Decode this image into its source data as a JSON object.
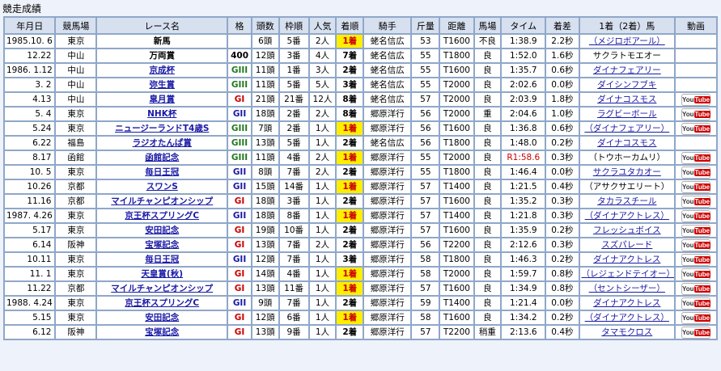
{
  "section_title": "競走成績",
  "headers": [
    "年月日",
    "競馬場",
    "レース名",
    "格",
    "頭数",
    "枠順",
    "人気",
    "着順",
    "騎手",
    "斤量",
    "距離",
    "馬場",
    "タイム",
    "着差",
    "1着（2着）馬",
    "動画"
  ],
  "grade_colors": {
    "GI": "#cc0000",
    "GII": "#1a1aa6",
    "GIII": "#227722",
    "400": "#000000"
  },
  "rows": [
    {
      "date": "1985.10. 6",
      "course": "東京",
      "race": "新馬",
      "race_link": false,
      "grade": "",
      "field": "6頭",
      "gate": "5番",
      "fav": "2人",
      "place": "1着",
      "jockey": "蛯名信広",
      "weight": "53",
      "distance": "T1600",
      "going": "不良",
      "time": "1:38.9",
      "record": "",
      "margin": "2.2秒",
      "winner": "（メジロボアール）",
      "winner_link": true,
      "video": false
    },
    {
      "date": "12.22",
      "course": "中山",
      "race": "万両賞",
      "race_link": false,
      "grade": "400",
      "field": "12頭",
      "gate": "3番",
      "fav": "4人",
      "place": "7着",
      "jockey": "蛯名信広",
      "weight": "55",
      "distance": "T1800",
      "going": "良",
      "time": "1:52.0",
      "record": "",
      "margin": "1.6秒",
      "winner": "サクラトモエオー",
      "winner_link": false,
      "video": false
    },
    {
      "date": "1986. 1.12",
      "course": "中山",
      "race": "京成杯",
      "race_link": true,
      "grade": "GIII",
      "field": "11頭",
      "gate": "1番",
      "fav": "3人",
      "place": "2着",
      "jockey": "蛯名信広",
      "weight": "55",
      "distance": "T1600",
      "going": "良",
      "time": "1:35.7",
      "record": "",
      "margin": "0.6秒",
      "winner": "ダイナフェアリー",
      "winner_link": true,
      "video": false
    },
    {
      "date": "3. 2",
      "course": "中山",
      "race": "弥生賞",
      "race_link": true,
      "grade": "GIII",
      "field": "11頭",
      "gate": "5番",
      "fav": "5人",
      "place": "3着",
      "jockey": "蛯名信広",
      "weight": "55",
      "distance": "T2000",
      "going": "良",
      "time": "2:02.6",
      "record": "",
      "margin": "0.0秒",
      "winner": "ダイシンフブキ",
      "winner_link": true,
      "video": false
    },
    {
      "date": "4.13",
      "course": "中山",
      "race": "皐月賞",
      "race_link": true,
      "grade": "GI",
      "field": "21頭",
      "gate": "21番",
      "fav": "12人",
      "place": "8着",
      "jockey": "蛯名信広",
      "weight": "57",
      "distance": "T2000",
      "going": "良",
      "time": "2:03.9",
      "record": "",
      "margin": "1.8秒",
      "winner": "ダイナコスモス",
      "winner_link": true,
      "video": true
    },
    {
      "date": "5. 4",
      "course": "東京",
      "race": "NHK杯",
      "race_link": true,
      "grade": "GII",
      "field": "18頭",
      "gate": "2番",
      "fav": "2人",
      "place": "8着",
      "jockey": "郷原洋行",
      "weight": "56",
      "distance": "T2000",
      "going": "重",
      "time": "2:04.6",
      "record": "",
      "margin": "1.0秒",
      "winner": "ラグビーボール",
      "winner_link": true,
      "video": true
    },
    {
      "date": "5.24",
      "course": "東京",
      "race": "ニュージーランドT4歳S",
      "race_link": true,
      "grade": "GIII",
      "field": "7頭",
      "gate": "2番",
      "fav": "1人",
      "place": "1着",
      "jockey": "郷原洋行",
      "weight": "56",
      "distance": "T1600",
      "going": "良",
      "time": "1:36.8",
      "record": "",
      "margin": "0.6秒",
      "winner": "（ダイナフェアリー）",
      "winner_link": true,
      "video": true
    },
    {
      "date": "6.22",
      "course": "福島",
      "race": "ラジオたんぱ賞",
      "race_link": true,
      "grade": "GIII",
      "field": "13頭",
      "gate": "5番",
      "fav": "1人",
      "place": "2着",
      "jockey": "蛯名信広",
      "weight": "56",
      "distance": "T1800",
      "going": "良",
      "time": "1:48.0",
      "record": "",
      "margin": "0.2秒",
      "winner": "ダイナコスモス",
      "winner_link": true,
      "video": false
    },
    {
      "date": "8.17",
      "course": "函館",
      "race": "函館記念",
      "race_link": true,
      "grade": "GIII",
      "field": "11頭",
      "gate": "4番",
      "fav": "2人",
      "place": "1着",
      "jockey": "郷原洋行",
      "weight": "55",
      "distance": "T2000",
      "going": "良",
      "time": "1:58.6",
      "record": "R",
      "margin": "0.3秒",
      "winner": "（トウホーカムリ）",
      "winner_link": false,
      "video": true
    },
    {
      "date": "10. 5",
      "course": "東京",
      "race": "毎日王冠",
      "race_link": true,
      "grade": "GII",
      "field": "8頭",
      "gate": "7番",
      "fav": "2人",
      "place": "2着",
      "jockey": "郷原洋行",
      "weight": "55",
      "distance": "T1800",
      "going": "良",
      "time": "1:46.4",
      "record": "",
      "margin": "0.0秒",
      "winner": "サクラユタカオー",
      "winner_link": true,
      "video": true
    },
    {
      "date": "10.26",
      "course": "京都",
      "race": "スワンS",
      "race_link": true,
      "grade": "GII",
      "field": "15頭",
      "gate": "14番",
      "fav": "1人",
      "place": "1着",
      "jockey": "郷原洋行",
      "weight": "57",
      "distance": "T1400",
      "going": "良",
      "time": "1:21.5",
      "record": "",
      "margin": "0.4秒",
      "winner": "（アサクサエリート）",
      "winner_link": false,
      "video": true
    },
    {
      "date": "11.16",
      "course": "京都",
      "race": "マイルチャンピオンシップ",
      "race_link": true,
      "grade": "GI",
      "field": "18頭",
      "gate": "3番",
      "fav": "1人",
      "place": "2着",
      "jockey": "郷原洋行",
      "weight": "57",
      "distance": "T1600",
      "going": "良",
      "time": "1:35.2",
      "record": "",
      "margin": "0.3秒",
      "winner": "タカラスチール",
      "winner_link": true,
      "video": true
    },
    {
      "date": "1987. 4.26",
      "course": "東京",
      "race": "京王杯スプリングC",
      "race_link": true,
      "grade": "GII",
      "field": "18頭",
      "gate": "8番",
      "fav": "1人",
      "place": "1着",
      "jockey": "郷原洋行",
      "weight": "57",
      "distance": "T1400",
      "going": "良",
      "time": "1:21.8",
      "record": "",
      "margin": "0.3秒",
      "winner": "（ダイナアクトレス）",
      "winner_link": true,
      "video": true
    },
    {
      "date": "5.17",
      "course": "東京",
      "race": "安田記念",
      "race_link": true,
      "grade": "GI",
      "field": "19頭",
      "gate": "10番",
      "fav": "1人",
      "place": "2着",
      "jockey": "郷原洋行",
      "weight": "57",
      "distance": "T1600",
      "going": "良",
      "time": "1:35.9",
      "record": "",
      "margin": "0.2秒",
      "winner": "フレッシュボイス",
      "winner_link": true,
      "video": true
    },
    {
      "date": "6.14",
      "course": "阪神",
      "race": "宝塚記念",
      "race_link": true,
      "grade": "GI",
      "field": "13頭",
      "gate": "7番",
      "fav": "2人",
      "place": "2着",
      "jockey": "郷原洋行",
      "weight": "56",
      "distance": "T2200",
      "going": "良",
      "time": "2:12.6",
      "record": "",
      "margin": "0.3秒",
      "winner": "スズパレード",
      "winner_link": true,
      "video": true
    },
    {
      "date": "10.11",
      "course": "東京",
      "race": "毎日王冠",
      "race_link": true,
      "grade": "GII",
      "field": "12頭",
      "gate": "7番",
      "fav": "1人",
      "place": "3着",
      "jockey": "郷原洋行",
      "weight": "58",
      "distance": "T1800",
      "going": "良",
      "time": "1:46.3",
      "record": "",
      "margin": "0.2秒",
      "winner": "ダイナアクトレス",
      "winner_link": true,
      "video": true
    },
    {
      "date": "11. 1",
      "course": "東京",
      "race": "天皇賞(秋)",
      "race_link": true,
      "grade": "GI",
      "field": "14頭",
      "gate": "4番",
      "fav": "1人",
      "place": "1着",
      "jockey": "郷原洋行",
      "weight": "58",
      "distance": "T2000",
      "going": "良",
      "time": "1:59.7",
      "record": "",
      "margin": "0.8秒",
      "winner": "（レジェンドテイオー）",
      "winner_link": true,
      "video": true
    },
    {
      "date": "11.22",
      "course": "京都",
      "race": "マイルチャンピオンシップ",
      "race_link": true,
      "grade": "GI",
      "field": "13頭",
      "gate": "11番",
      "fav": "1人",
      "place": "1着",
      "jockey": "郷原洋行",
      "weight": "57",
      "distance": "T1600",
      "going": "良",
      "time": "1:34.9",
      "record": "",
      "margin": "0.8秒",
      "winner": "（セントシーザー）",
      "winner_link": true,
      "video": true
    },
    {
      "date": "1988. 4.24",
      "course": "東京",
      "race": "京王杯スプリングC",
      "race_link": true,
      "grade": "GII",
      "field": "9頭",
      "gate": "7番",
      "fav": "1人",
      "place": "2着",
      "jockey": "郷原洋行",
      "weight": "59",
      "distance": "T1400",
      "going": "良",
      "time": "1:21.4",
      "record": "",
      "margin": "0.0秒",
      "winner": "ダイナアクトレス",
      "winner_link": true,
      "video": true
    },
    {
      "date": "5.15",
      "course": "東京",
      "race": "安田記念",
      "race_link": true,
      "grade": "GI",
      "field": "12頭",
      "gate": "6番",
      "fav": "1人",
      "place": "1着",
      "jockey": "郷原洋行",
      "weight": "58",
      "distance": "T1600",
      "going": "良",
      "time": "1:34.2",
      "record": "",
      "margin": "0.2秒",
      "winner": "（ダイナアクトレス）",
      "winner_link": true,
      "video": true
    },
    {
      "date": "6.12",
      "course": "阪神",
      "race": "宝塚記念",
      "race_link": true,
      "grade": "GI",
      "field": "13頭",
      "gate": "9番",
      "fav": "1人",
      "place": "2着",
      "jockey": "郷原洋行",
      "weight": "57",
      "distance": "T2200",
      "going": "稍重",
      "time": "2:13.6",
      "record": "",
      "margin": "0.4秒",
      "winner": "タマモクロス",
      "winner_link": true,
      "video": true
    }
  ]
}
